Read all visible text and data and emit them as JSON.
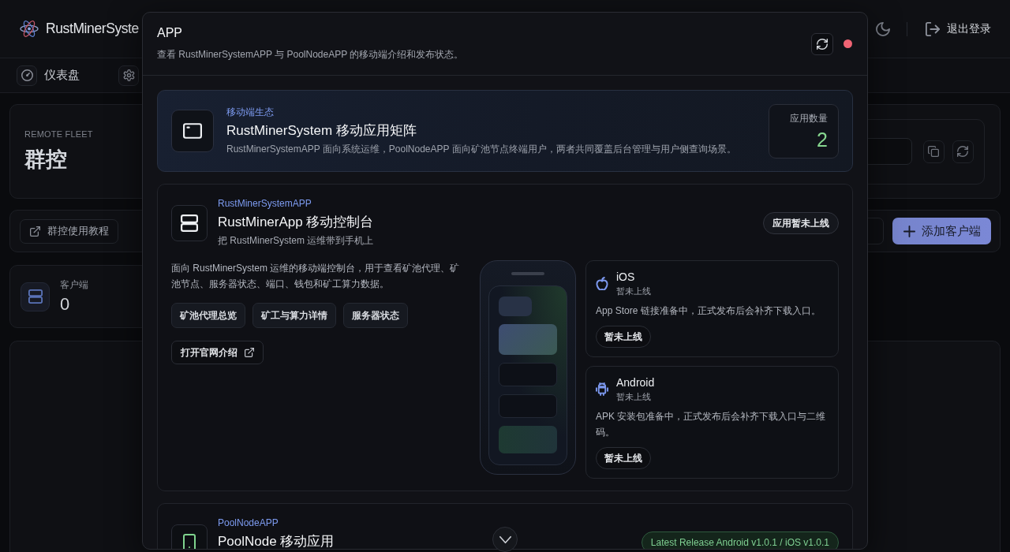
{
  "header": {
    "brand": "RustMinerSyste",
    "logout": "退出登录"
  },
  "nav": {
    "items": [
      {
        "kind": "dashboard",
        "label": "仪表盘"
      },
      {
        "kind": "settings"
      }
    ]
  },
  "fleet": {
    "eyebrow": "REMOTE FLEET",
    "title": "群控"
  },
  "toolbar": {
    "tutorial": "群控使用教程",
    "add_client": "添加客户端"
  },
  "stats": [
    {
      "label": "客户端",
      "value": "0"
    }
  ],
  "modal": {
    "title": "APP",
    "subtitle": "查看 RustMinerSystemAPP 与 PoolNodeAPP 的移动端介绍和发布状态。",
    "hero": {
      "eyebrow": "移动端生态",
      "title": "RustMinerSystem 移动应用矩阵",
      "description": "RustMinerSystemAPP 面向系统运维，PoolNodeAPP 面向矿池节点终端用户，两者共同覆盖后台管理与用户侧查询场景。",
      "stat_label": "应用数量",
      "stat_value": "2"
    },
    "apps": [
      {
        "kind": "console",
        "eyebrow": "RustMinerSystemAPP",
        "title": "RustMinerApp 移动控制台",
        "subtitle": "把 RustMinerSystem 运维带到手机上",
        "badge": {
          "kind": "pending",
          "text": "应用暂未上线"
        },
        "description": "面向 RustMinerSystem 运维的移动端控制台，用于查看矿池代理、矿池节点、服务器状态、端口、钱包和矿工算力数据。",
        "features": [
          "矿池代理总览",
          "矿工与算力详情",
          "服务器状态"
        ],
        "link": "打开官网介绍",
        "platforms": [
          {
            "kind": "ios",
            "name": "iOS",
            "status": "暂未上线",
            "description": "App Store 链接准备中，正式发布后会补齐下载入口。",
            "button": "暂未上线"
          },
          {
            "kind": "android",
            "name": "Android",
            "status": "暂未上线",
            "description": "APK 安装包准备中，正式发布后会补齐下载入口与二维码。",
            "button": "暂未上线"
          }
        ]
      },
      {
        "kind": "pool",
        "eyebrow": "PoolNodeAPP",
        "title": "PoolNode 移动应用",
        "badge": {
          "kind": "release",
          "text": "Latest Release Android v1.0.1 / iOS v1.0.1"
        }
      }
    ]
  }
}
